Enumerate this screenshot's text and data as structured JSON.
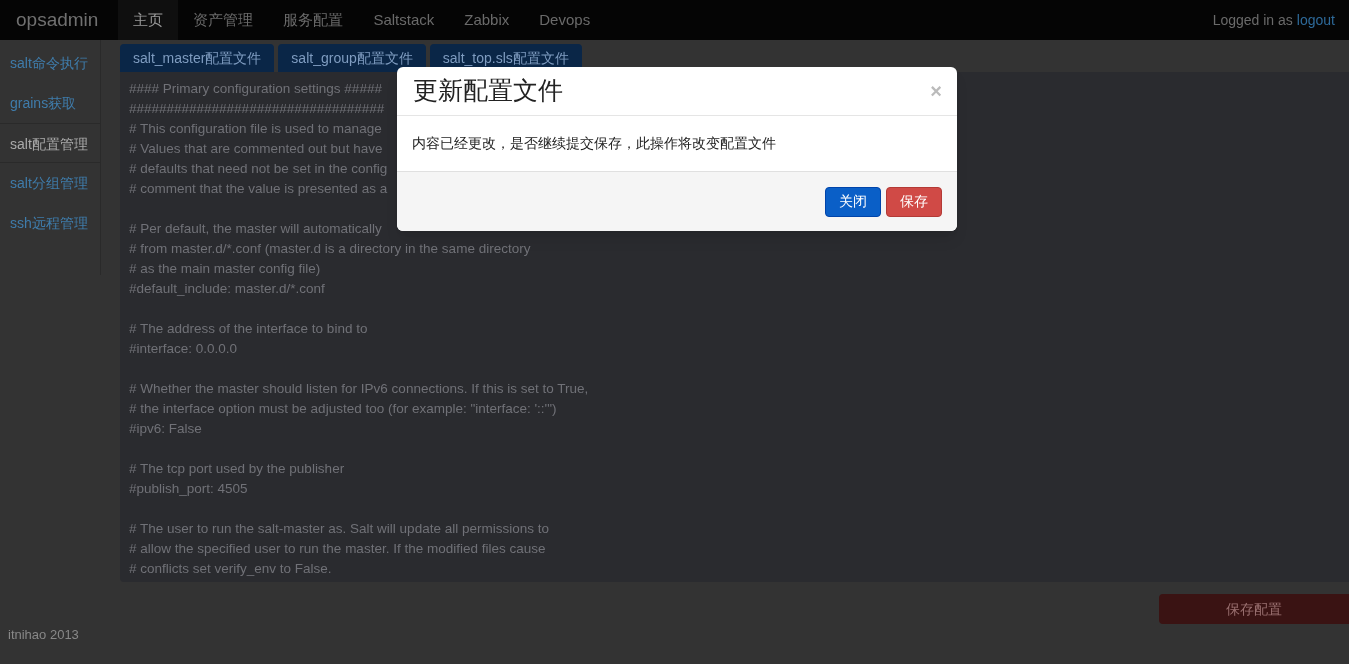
{
  "navbar": {
    "brand": "opsadmin",
    "items": [
      {
        "label": "主页",
        "selected": true
      },
      {
        "label": "资产管理",
        "selected": false
      },
      {
        "label": "服务配置",
        "selected": false
      },
      {
        "label": "Saltstack",
        "selected": false
      },
      {
        "label": "Zabbix",
        "selected": false
      },
      {
        "label": "Devops",
        "selected": false
      }
    ],
    "user_text": "Logged in as",
    "logout": "logout"
  },
  "sidebar": {
    "items": [
      {
        "label": "salt命令执行",
        "selected": false
      },
      {
        "label": "grains获取",
        "selected": false
      },
      {
        "label": "salt配置管理",
        "selected": true
      },
      {
        "label": "salt分组管理",
        "selected": false
      },
      {
        "label": "ssh远程管理",
        "selected": false
      }
    ]
  },
  "file_tabs": [
    {
      "label": "salt_master配置文件"
    },
    {
      "label": "salt_group配置文件"
    },
    {
      "label": "salt_top.sls配置文件"
    }
  ],
  "editor": {
    "blocks": [
      [
        "#### Primary configuration settings #####",
        "##################################",
        "# This configuration file is used to manage",
        "# Values that are commented out but have",
        "# defaults that need not be set in the config",
        "# comment that the value is presented as a"
      ],
      [
        "# Per default, the master will automatically",
        "# from master.d/*.conf (master.d is a directory in the same directory",
        "# as the main master config file)",
        "#default_include: master.d/*.conf"
      ],
      [
        "# The address of the interface to bind to",
        "#interface: 0.0.0.0"
      ],
      [
        "# Whether the master should listen for IPv6 connections. If this is set to True,",
        "# the interface option must be adjusted too (for example: \"interface: '::'\")",
        "#ipv6: False"
      ],
      [
        "# The tcp port used by the publisher",
        "#publish_port: 4505"
      ],
      [
        "# The user to run the salt-master as. Salt will update all permissions to",
        "# allow the specified user to run the master. If the modified files cause",
        "# conflicts set verify_env to False."
      ]
    ]
  },
  "save_button": "保存配置",
  "footer": "itnihao 2013",
  "modal": {
    "title": "更新配置文件",
    "close": "×",
    "message": "内容已经更改，是否继续提交保存，此操作将改变配置文件",
    "buttons": [
      {
        "label": "关闭",
        "kind": "primary"
      },
      {
        "label": "保存",
        "kind": "danger"
      }
    ]
  }
}
